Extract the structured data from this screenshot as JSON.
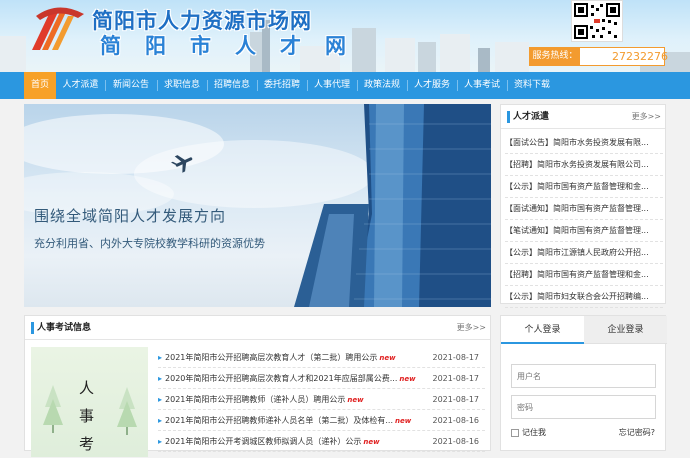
{
  "header": {
    "title": "简阳市人力资源市场网",
    "subtitle": "简阳市人才网",
    "hotline_label": "服务热线：",
    "hotline_number": "27232276"
  },
  "nav": {
    "items": [
      {
        "label": "首页",
        "active": true
      },
      {
        "label": "人才派遣"
      },
      {
        "label": "新闻公告"
      },
      {
        "label": "求职信息"
      },
      {
        "label": "招聘信息"
      },
      {
        "label": "委托招聘"
      },
      {
        "label": "人事代理"
      },
      {
        "label": "政策法规"
      },
      {
        "label": "人才服务"
      },
      {
        "label": "人事考试"
      },
      {
        "label": "资料下载"
      }
    ]
  },
  "banner": {
    "headline": "围绕全域简阳人才发展方向",
    "subline": "充分利用省、内外大专院校教学科研的资源优势"
  },
  "side_panel": {
    "title": "人才派遣",
    "more": "更多>>",
    "items": [
      "【面试公告】简阳市水务投资发展有限...",
      "【招聘】简阳市水务投资发展有限公司...",
      "【公示】简阳市国有资产监督管理和金...",
      "【面试通知】简阳市国有资产监督管理...",
      "【笔试通知】简阳市国有资产监督管理...",
      "【公示】简阳市江源镇人民政府公开招...",
      "【招聘】简阳市国有资产监督管理和金...",
      "【公示】简阳市妇女联合会公开招聘编..."
    ]
  },
  "exam": {
    "title": "人事考试信息",
    "more": "更多>>",
    "image_text": "人事考",
    "new_badge": "new",
    "rows": [
      {
        "title": "2021年简阳市公开招聘高层次教育人才（第二批）聘用公示",
        "date": "2021-08-17"
      },
      {
        "title": "2020年简阳市公开招聘高层次教育人才和2021年应届部属公费...",
        "date": "2021-08-17"
      },
      {
        "title": "2021年简阳市公开招聘教师（递补人员）聘用公示",
        "date": "2021-08-17"
      },
      {
        "title": "2021年简阳市公开招聘教师递补人员名单（第二批）及体检有...",
        "date": "2021-08-16"
      },
      {
        "title": "2021年简阳市公开考调城区教师拟调人员（递补）公示",
        "date": "2021-08-16"
      }
    ]
  },
  "login": {
    "tab_personal": "个人登录",
    "tab_company": "企业登录",
    "username_placeholder": "用户名",
    "password_placeholder": "密码",
    "remember": "记住我",
    "forgot": "忘记密码?"
  }
}
